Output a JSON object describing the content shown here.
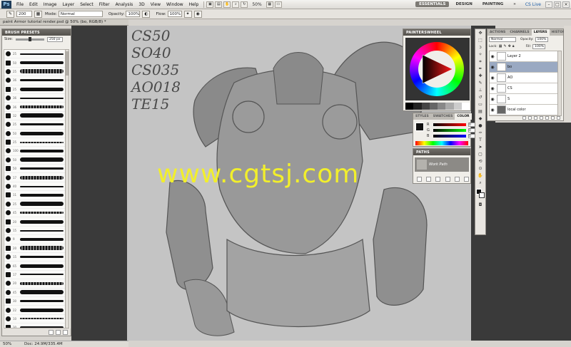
{
  "app": {
    "logo": "Ps",
    "menu": [
      "File",
      "Edit",
      "Image",
      "Layer",
      "Select",
      "Filter",
      "Analysis",
      "3D",
      "View",
      "Window",
      "Help"
    ],
    "zoom": "50%",
    "workspaces": [
      "ESSENTIALS",
      "DESIGN",
      "PAINTING"
    ],
    "active_workspace": "ESSENTIALS",
    "cs_live": "CS Live",
    "win_controls": [
      "–",
      "□",
      "×"
    ]
  },
  "options": {
    "brush_size": "200",
    "mode_label": "Mode:",
    "mode_value": "Normal",
    "opacity_label": "Opacity:",
    "opacity_value": "100%",
    "flow_label": "Flow:",
    "flow_value": "100%"
  },
  "document": {
    "tab_title": "paint Armor tutorial render.psd @ 50% (bo, RGB/8) *",
    "status_zoom": "50%",
    "status_doc": "Doc: 24.9M/335.4M"
  },
  "brush_presets": {
    "title": "BRUSH PRESETS",
    "size_label": "Size:",
    "size_value": "250 px",
    "numbers": [
      "25",
      "50",
      "25",
      "36",
      "25",
      "36",
      "36",
      "32",
      "25",
      "50",
      "25",
      "100",
      "50",
      "50",
      "17",
      "40",
      "11",
      "25",
      "45",
      "20",
      "15",
      "9",
      "20",
      "15",
      "65",
      "17",
      "20",
      "45",
      "30",
      "22",
      "10",
      "30"
    ]
  },
  "canvas": {
    "notes": [
      "CS50",
      "SO40",
      "CS035",
      "AO018",
      "TE15"
    ],
    "watermark": "www.cgtsj.com"
  },
  "color_wheel": {
    "title": "PAINTERSWHEEL"
  },
  "color_panel": {
    "tabs": [
      "STYLES",
      "SWATCHES",
      "COLOR"
    ],
    "active_tab": "COLOR",
    "r_label": "R",
    "r_value": "0",
    "g_label": "G",
    "g_value": "0",
    "b_label": "B",
    "b_value": "0"
  },
  "paths_panel": {
    "title": "PATHS",
    "item": "Work Path"
  },
  "layers_panel": {
    "tabs": [
      "ACTIONS",
      "CHANNELS",
      "LAYERS",
      "HISTORY"
    ],
    "active_tab": "LAYERS",
    "blend_mode": "Normal",
    "opacity_label": "Opacity:",
    "opacity_value": "100%",
    "lock_label": "Lock:",
    "fill_label": "Fill:",
    "fill_value": "100%",
    "layers": [
      {
        "name": "Layer 2",
        "selected": false
      },
      {
        "name": "bo",
        "selected": true
      },
      {
        "name": "AO",
        "selected": false
      },
      {
        "name": "CS",
        "selected": false
      },
      {
        "name": "S",
        "selected": false
      },
      {
        "name": "local color",
        "selected": false
      }
    ]
  },
  "colors": {
    "canvas_bg": "#c4c4c4",
    "dark_bg": "#3a3a3a",
    "watermark": "#f2ef2b",
    "panel_bg": "#f0eee9",
    "selected_layer": "#9aa9c2"
  }
}
